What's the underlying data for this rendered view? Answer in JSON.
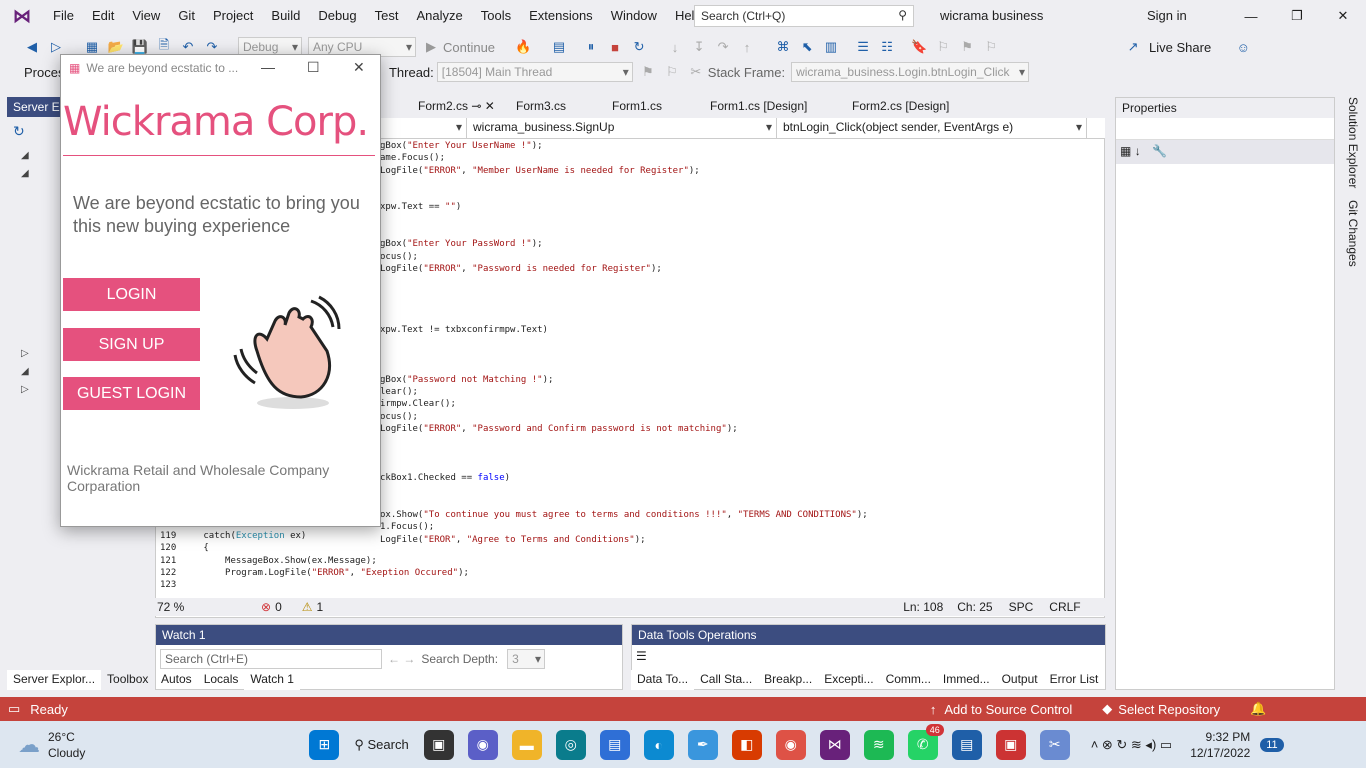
{
  "menu": {
    "items": [
      "File",
      "Edit",
      "View",
      "Git",
      "Project",
      "Build",
      "Debug",
      "Test",
      "Analyze",
      "Tools",
      "Extensions",
      "Window",
      "Help"
    ],
    "search_placeholder": "Search (Ctrl+Q)",
    "solution": "wicrama business",
    "sign_in": "Sign in"
  },
  "toolbar": {
    "config": "Debug",
    "platform": "Any CPU",
    "continue": "Continue",
    "live_share": "Live Share"
  },
  "debugbar": {
    "process": "Process",
    "thread_label": "Thread:",
    "thread": "[18504] Main Thread",
    "stack_label": "Stack Frame:",
    "stack": "wicrama_business.Login.btnLogin_Click"
  },
  "tabs": [
    "Form2.cs",
    "Form3.cs",
    "Form1.cs",
    "Form1.cs [Design]",
    "Form2.cs [Design]"
  ],
  "nav": {
    "class": "wicrama_business.SignUp",
    "method": "btnLogin_Click(object sender, EventArgs e)"
  },
  "code": [
    "gBox(\"Enter Your UserName !\");",
    "ame.Focus();",
    "LogFile(\"ERROR\", \"Member UserName is needed for Register\");",
    "",
    "",
    "xpw.Text == \"\")",
    "",
    "",
    "gBox(\"Enter Your PassWord !\");",
    "ocus();",
    "LogFile(\"ERROR\", \"Password is needed for Register\");",
    "",
    "",
    "",
    "",
    "xpw.Text != txbxconfirmpw.Text)",
    "",
    "",
    "",
    "gBox(\"Password not Matching !\");",
    "lear();",
    "irmpw.Clear();",
    "ocus();",
    "LogFile(\"ERROR\", \"Password and Confirm password is not matching\");",
    "",
    "",
    "",
    "ckBox1.Checked == false)",
    "",
    "",
    "ox.Show(\"To continue you must agree to terms and conditions !!!\", \"TERMS AND CONDITIONS\");",
    "1.Focus();",
    "LogFile(\"EROR\", \"Agree to Terms and Conditions\");"
  ],
  "code_bottom": [
    {
      "n": "119",
      "t": "catch(Exception ex)"
    },
    {
      "n": "120",
      "t": "{"
    },
    {
      "n": "121",
      "t": "    MessageBox.Show(ex.Message);"
    },
    {
      "n": "122",
      "t": "    Program.LogFile(\"ERROR\", \"Exeption Occured\");"
    },
    {
      "n": "123",
      "t": ""
    }
  ],
  "editor_status": {
    "zoom": "72 %",
    "errors": "0",
    "warnings": "1",
    "ln": "Ln: 108",
    "ch": "Ch: 25",
    "spc": "SPC",
    "crlf": "CRLF"
  },
  "panes": {
    "server": "Server Ex",
    "properties": "Properties",
    "watch": "Watch 1",
    "watch_search": "Search (Ctrl+E)",
    "search_depth": "Search Depth:",
    "depth": "3",
    "dto": "Data Tools Operations",
    "solution_explorer": "Solution Explorer",
    "git_changes": "Git Changes"
  },
  "bottom_left_tabs": [
    "Server Explor...",
    "Toolbox"
  ],
  "watch_tabs": [
    "Autos",
    "Locals",
    "Watch 1"
  ],
  "dto_tabs": [
    "Data To...",
    "Call Sta...",
    "Breakp...",
    "Excepti...",
    "Comm...",
    "Immed...",
    "Output",
    "Error List"
  ],
  "status": {
    "ready": "Ready",
    "add_source": "Add to Source Control",
    "repo": "Select Repository",
    "notif": "2"
  },
  "taskbar": {
    "temp": "26°C",
    "weather": "Cloudy",
    "search": "Search",
    "time": "9:32 PM",
    "date": "12/17/2022",
    "notif": "11",
    "badge_whatsapp": "46"
  },
  "form": {
    "title": "We are beyond ecstatic to ...",
    "brand": "Wickrama Corp.",
    "tagline": "We are beyond ecstatic to bring you this new buying experience",
    "login": "LOGIN",
    "signup": "SIGN UP",
    "guest": "GUEST LOGIN",
    "footer": "Wickrama Retail and Wholesale Company Corparation"
  },
  "colors": {
    "brand": "#e5517e",
    "status": "#c5433c",
    "tab_active": "#f5cc84"
  }
}
